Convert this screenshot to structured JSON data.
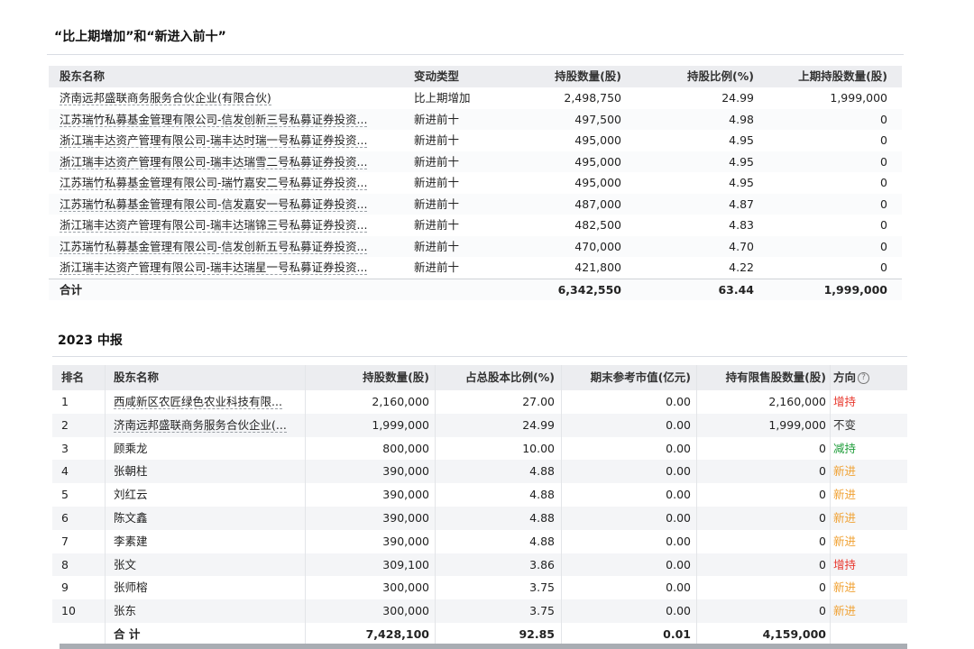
{
  "section1": {
    "title": "“比上期增加”和“新进入前十”",
    "headers": {
      "name": "股东名称",
      "type": "变动类型",
      "qty": "持股数量(股)",
      "pct": "持股比例(%)",
      "prev": "上期持股数量(股)"
    },
    "rows": [
      {
        "name": "济南远邦盛联商务服务合伙企业(有限合伙)",
        "type": "比上期增加",
        "qty": "2,498,750",
        "pct": "24.99",
        "prev": "1,999,000"
      },
      {
        "name": "江苏瑞竹私募基金管理有限公司-信发创新三号私募证券投资...",
        "type": "新进前十",
        "qty": "497,500",
        "pct": "4.98",
        "prev": "0"
      },
      {
        "name": "浙江瑞丰达资产管理有限公司-瑞丰达时瑞一号私募证券投资...",
        "type": "新进前十",
        "qty": "495,000",
        "pct": "4.95",
        "prev": "0"
      },
      {
        "name": "浙江瑞丰达资产管理有限公司-瑞丰达瑞雪二号私募证券投资...",
        "type": "新进前十",
        "qty": "495,000",
        "pct": "4.95",
        "prev": "0"
      },
      {
        "name": "江苏瑞竹私募基金管理有限公司-瑞竹嘉安二号私募证券投资...",
        "type": "新进前十",
        "qty": "495,000",
        "pct": "4.95",
        "prev": "0"
      },
      {
        "name": "江苏瑞竹私募基金管理有限公司-信发嘉安一号私募证券投资...",
        "type": "新进前十",
        "qty": "487,000",
        "pct": "4.87",
        "prev": "0"
      },
      {
        "name": "浙江瑞丰达资产管理有限公司-瑞丰达瑞锦三号私募证券投资...",
        "type": "新进前十",
        "qty": "482,500",
        "pct": "4.83",
        "prev": "0"
      },
      {
        "name": "江苏瑞竹私募基金管理有限公司-信发创新五号私募证券投资...",
        "type": "新进前十",
        "qty": "470,000",
        "pct": "4.70",
        "prev": "0"
      },
      {
        "name": "浙江瑞丰达资产管理有限公司-瑞丰达瑞星一号私募证券投资...",
        "type": "新进前十",
        "qty": "421,800",
        "pct": "4.22",
        "prev": "0"
      }
    ],
    "total": {
      "label": "合计",
      "qty": "6,342,550",
      "pct": "63.44",
      "prev": "1,999,000"
    }
  },
  "section2": {
    "title": "2023 中报",
    "headers": {
      "rank": "排名",
      "name": "股东名称",
      "qty": "持股数量(股)",
      "ratio": "占总股本比例(%)",
      "mv": "期末参考市值(亿元)",
      "lim": "持有限售股数量(股)",
      "dir": "方向"
    },
    "help_icon": "?",
    "rows": [
      {
        "rank": "1",
        "name": "西咸新区农匠绿色农业科技有限...",
        "qty": "2,160,000",
        "ratio": "27.00",
        "mv": "0.00",
        "lim": "2,160,000",
        "dir": "增持",
        "dir_color": "#e8372c"
      },
      {
        "rank": "2",
        "name": "济南远邦盛联商务服务合伙企业(...",
        "qty": "1,999,000",
        "ratio": "24.99",
        "mv": "0.00",
        "lim": "1,999,000",
        "dir": "不变",
        "dir_color": "#333333"
      },
      {
        "rank": "3",
        "name": "顾乘龙",
        "qty": "800,000",
        "ratio": "10.00",
        "mv": "0.00",
        "lim": "0",
        "dir": "减持",
        "dir_color": "#1f9d3a"
      },
      {
        "rank": "4",
        "name": "张朝柱",
        "qty": "390,000",
        "ratio": "4.88",
        "mv": "0.00",
        "lim": "0",
        "dir": "新进",
        "dir_color": "#f0a030"
      },
      {
        "rank": "5",
        "name": "刘红云",
        "qty": "390,000",
        "ratio": "4.88",
        "mv": "0.00",
        "lim": "0",
        "dir": "新进",
        "dir_color": "#f0a030"
      },
      {
        "rank": "6",
        "name": "陈文鑫",
        "qty": "390,000",
        "ratio": "4.88",
        "mv": "0.00",
        "lim": "0",
        "dir": "新进",
        "dir_color": "#f0a030"
      },
      {
        "rank": "7",
        "name": "李素建",
        "qty": "390,000",
        "ratio": "4.88",
        "mv": "0.00",
        "lim": "0",
        "dir": "新进",
        "dir_color": "#f0a030"
      },
      {
        "rank": "8",
        "name": "张文",
        "qty": "309,100",
        "ratio": "3.86",
        "mv": "0.00",
        "lim": "0",
        "dir": "增持",
        "dir_color": "#e8372c"
      },
      {
        "rank": "9",
        "name": "张师榕",
        "qty": "300,000",
        "ratio": "3.75",
        "mv": "0.00",
        "lim": "0",
        "dir": "新进",
        "dir_color": "#f0a030"
      },
      {
        "rank": "10",
        "name": "张东",
        "qty": "300,000",
        "ratio": "3.75",
        "mv": "0.00",
        "lim": "0",
        "dir": "新进",
        "dir_color": "#f0a030"
      }
    ],
    "total": {
      "label": "合 计",
      "qty": "7,428,100",
      "ratio": "92.85",
      "mv": "0.01",
      "lim": "4,159,000"
    }
  }
}
